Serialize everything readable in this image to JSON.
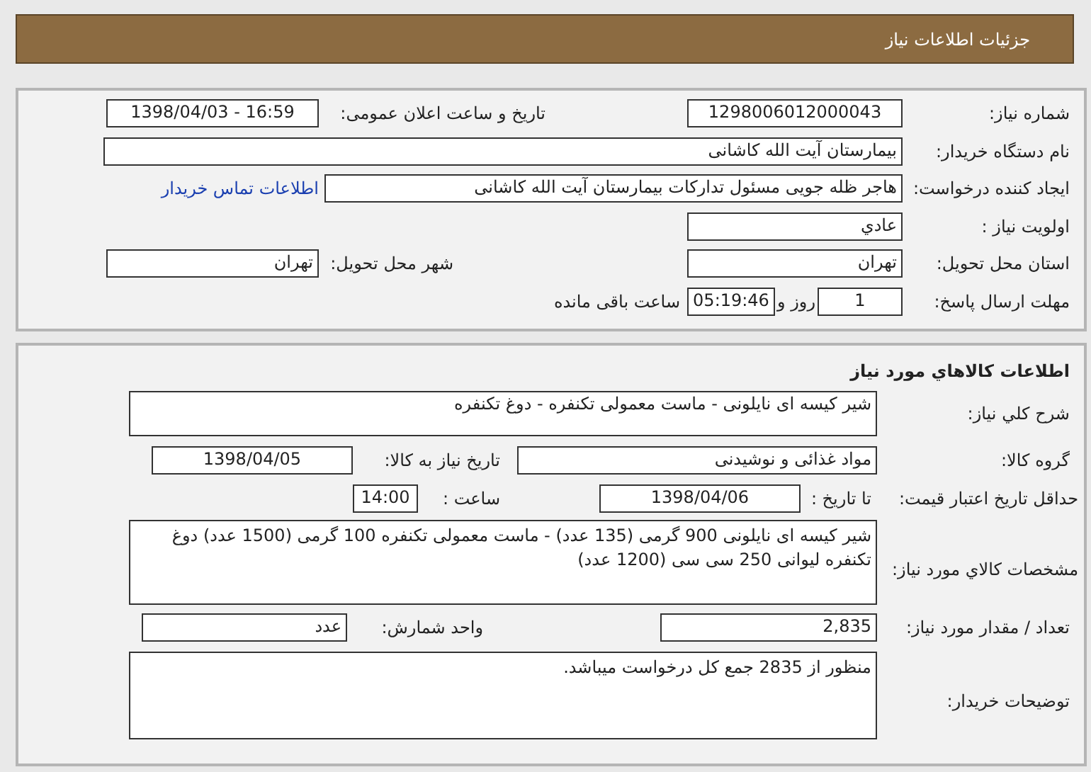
{
  "header": {
    "title": "جزئیات اطلاعات نیاز"
  },
  "need_info": {
    "need_number": {
      "label": "شماره نیاز:",
      "value": "1298006012000043"
    },
    "announce_datetime": {
      "label": "تاریخ و ساعت اعلان عمومی:",
      "value": "1398/04/03 - 16:59"
    },
    "buyer_org": {
      "label": "نام دستگاه خریدار:",
      "value": "بیمارستان آیت الله کاشانی"
    },
    "requester": {
      "label": "ایجاد کننده درخواست:",
      "value": "هاجر ظله جویی مسئول تدارکات بیمارستان آیت الله کاشانی"
    },
    "contact_link": "اطلاعات تماس خریدار",
    "priority": {
      "label": "اولویت نیاز :",
      "value": "عادي"
    },
    "province": {
      "label": "استان محل تحویل:",
      "value": "تهران"
    },
    "city": {
      "label": "شهر محل تحویل:",
      "value": "تهران"
    },
    "deadline": {
      "label": "مهلت ارسال پاسخ:",
      "days": "1",
      "days_label": "روز و",
      "time": "05:19:46",
      "time_label": "ساعت باقی مانده"
    }
  },
  "goods": {
    "title": "اطلاعات کالاهاي مورد نياز",
    "description": {
      "label": "شرح کلي نياز:",
      "value": "شير کيسه ای نايلونی - ماست معمولی تکنفره - دوغ تکنفره"
    },
    "group": {
      "label": "گروه کالا:",
      "value": "مواد غذائی و نوشیدنی"
    },
    "need_date": {
      "label": "تاریخ نیاز به کالا:",
      "value": "1398/04/05"
    },
    "price_validity": {
      "label": "حداقل تاریخ اعتبار قیمت:",
      "to_date_label": "تا تاریخ :",
      "date": "1398/04/06",
      "time_label": "ساعت :",
      "time": "14:00"
    },
    "specs": {
      "label": "مشخصات کالاي مورد نياز:",
      "value": "شير کيسه ای نايلونی 900 گرمی (135 عدد) - ماست معمولی تکنفره 100 گرمی (1500 عدد) دوغ تکنفره ليوانی 250 سی سی (1200 عدد)"
    },
    "quantity": {
      "label": "تعداد / مقدار مورد نیاز:",
      "value": "2,835"
    },
    "unit": {
      "label": "واحد شمارش:",
      "value": "عدد"
    },
    "buyer_notes": {
      "label": "توضیحات خریدار:",
      "value": "منظور از 2835 جمع کل درخواست میباشد."
    }
  }
}
